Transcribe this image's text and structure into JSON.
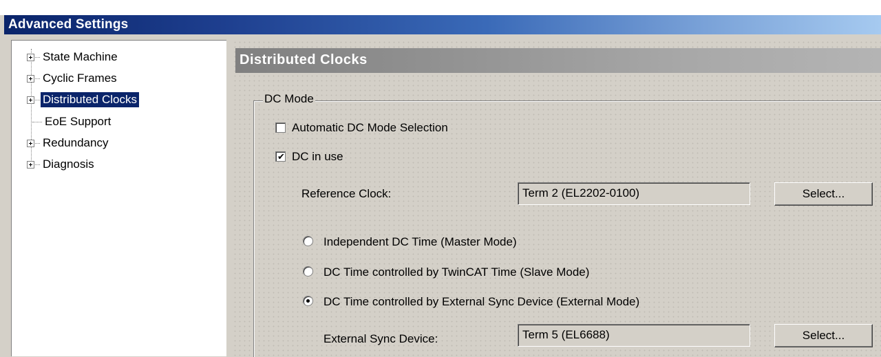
{
  "window": {
    "title": "Advanced Settings"
  },
  "tree": {
    "items": [
      {
        "label": "State Machine",
        "expandable": true,
        "selected": false
      },
      {
        "label": "Cyclic Frames",
        "expandable": true,
        "selected": false
      },
      {
        "label": "Distributed Clocks",
        "expandable": true,
        "selected": true
      },
      {
        "label": "EoE Support",
        "expandable": false,
        "selected": false
      },
      {
        "label": "Redundancy",
        "expandable": true,
        "selected": false
      },
      {
        "label": "Diagnosis",
        "expandable": true,
        "selected": false
      }
    ]
  },
  "panel": {
    "header": "Distributed Clocks",
    "group_label": "DC Mode",
    "auto_dc": {
      "label": "Automatic DC Mode Selection",
      "checked": false
    },
    "dc_in_use": {
      "label": "DC in use",
      "checked": true
    },
    "reference_clock": {
      "label": "Reference Clock:",
      "value": "Term 2 (EL2202-0100)",
      "button": "Select..."
    },
    "modes": [
      {
        "label": "Independent DC Time (Master Mode)",
        "selected": false
      },
      {
        "label": "DC Time controlled by TwinCAT Time (Slave Mode)",
        "selected": false
      },
      {
        "label": "DC Time controlled by External Sync Device (External Mode)",
        "selected": true
      }
    ],
    "external_sync": {
      "label": "External Sync Device:",
      "value": "Term 5 (EL6688)",
      "button": "Select..."
    }
  },
  "icons": {
    "expander": "plus-box-icon",
    "check": "checkmark-icon",
    "radio": "radio-dot-icon"
  }
}
